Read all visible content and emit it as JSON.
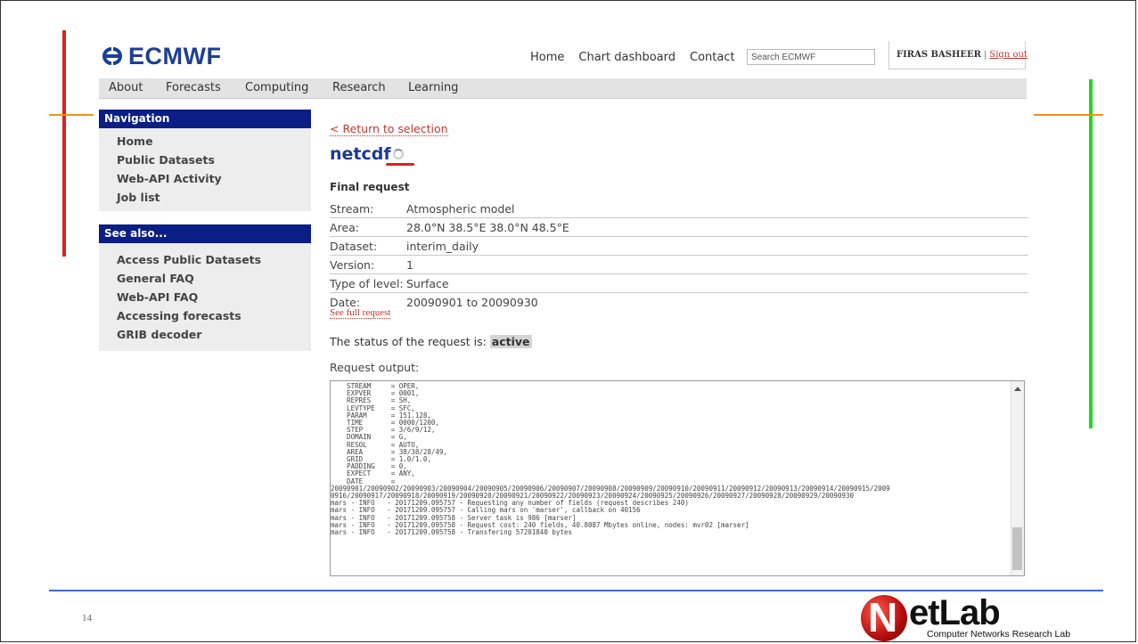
{
  "header": {
    "logo_text": "ECMWF",
    "nav": [
      "Home",
      "Chart dashboard",
      "Contact"
    ],
    "search_placeholder": "Search ECMWF",
    "user_name": "FIRAS BASHEER",
    "separator": "|",
    "sign_out": "Sign out"
  },
  "main_nav": [
    "About",
    "Forecasts",
    "Computing",
    "Research",
    "Learning"
  ],
  "sidebar": {
    "navigation_title": "Navigation",
    "navigation_items": [
      "Home",
      "Public Datasets",
      "Web-API Activity",
      "Job list"
    ],
    "see_also_title": "See also...",
    "see_also_items": [
      "Access Public Datasets",
      "General FAQ",
      "Web-API FAQ",
      "Accessing forecasts",
      "GRIB decoder"
    ]
  },
  "content": {
    "return_link": "< Return to selection",
    "title": "netcdf",
    "final_request_label": "Final request",
    "request_rows": [
      {
        "key": "Stream:",
        "value": "Atmospheric model"
      },
      {
        "key": "Area:",
        "value": "28.0°N 38.5°E 38.0°N 48.5°E"
      },
      {
        "key": "Dataset:",
        "value": "interim_daily"
      },
      {
        "key": "Version:",
        "value": "1"
      },
      {
        "key": "Type of level:",
        "value": "Surface"
      },
      {
        "key": "Date:",
        "value": "20090901 to 20090930"
      }
    ],
    "see_full_request": "See full request",
    "status_prefix": "The status of the request is:",
    "status_value": "active",
    "request_output_label": "Request output:",
    "output_text": "    STREAM     = OPER,\n    EXPVER     = 0001,\n    REPRES     = SH,\n    LEVTYPE    = SFC,\n    PARAM      = 151.128,\n    TIME       = 0000/1200,\n    STEP       = 3/6/9/12,\n    DOMAIN     = G,\n    RESOL      = AUTO,\n    AREA       = 38/38/28/49,\n    GRID       = 1.0/1.0,\n    PADDING    = 0,\n    EXPECT     = ANY,\n    DATE       =\n20090901/20090902/20090903/20090904/20090905/20090906/20090907/20090908/20090909/20090910/20090911/20090912/20090913/20090914/20090915/2009\n0916/20090917/20090918/20090919/20090920/20090921/20090922/20090923/20090924/20090925/20090926/20090927/20090928/20090929/20090930\nmars - INFO   - 20171209.095757 - Requesting any number of fields (request describes 240)\nmars - INFO   - 20171209.095757 - Calling mars on 'marser', callback on 40156\nmars - INFO   - 20171209.095758 - Server task is 986 [marser]\nmars - INFO   - 20171209.095758 - Request cost: 240 fields, 40.8087 Mbytes online, nodes: mvr02 [marser]\nmars - INFO   - 20171209.095758 - Transfering 57201840 bytes"
  },
  "slide": {
    "page_number": "14",
    "logo_word": "etLab",
    "logo_letter": "N",
    "logo_subtitle": "Computer Networks Research Lab"
  },
  "colors": {
    "nav_header_bg": "#0a1e85",
    "title_blue": "#1d3a8f",
    "link_red": "#c0392b",
    "bottom_line": "#3c6ad6"
  }
}
